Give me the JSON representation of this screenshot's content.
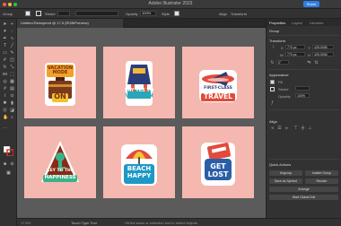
{
  "app": {
    "title": "Adobe Illustrator 2023",
    "share_label": "Share"
  },
  "control_bar": {
    "selection": "Group",
    "stroke_label": "Stroke",
    "opacity_label": "Opacity",
    "opacity_value": "100%",
    "style_label": "Style",
    "align_label": "Align",
    "transform_label": "Transform"
  },
  "document": {
    "tab_label": "Untitled-Reinspired @ 17.5 (RGB/Preview)"
  },
  "status": {
    "zoom": "17.5%",
    "tool_name": "Touch Type Tool",
    "hint": "Hit the lasso or selection tool to select objects"
  },
  "stickers": {
    "s1": {
      "line1": "VACATION",
      "line2": "MODE",
      "line3": "ON"
    },
    "s2": {
      "line1": "SAY YES TO",
      "line2": "VACATION"
    },
    "s3": {
      "line1": "FIRST-CLASS",
      "line2": "TRAVEL"
    },
    "s4": {
      "line1": "KEY TO THE",
      "line2": "HAPPINESS"
    },
    "s5": {
      "line1": "BEACH",
      "line2": "HAPPY"
    },
    "s6": {
      "line1": "GET",
      "line2": "LOST"
    }
  },
  "panel": {
    "tabs": [
      "Properties",
      "Layers",
      "Libraries"
    ],
    "group_label": "Group",
    "transform_head": "Transform",
    "x": "770 px",
    "y": "425.0006",
    "w": "770 px",
    "h": "425.0006",
    "rotate": "0°",
    "appearance_head": "Appearance",
    "fill_label": "Fill",
    "stroke_label": "Stroke",
    "opacity_label": "Opacity",
    "opacity_value": "100%",
    "align_head": "Align",
    "quick_actions_head": "Quick Actions",
    "btn_ungroup": "Ungroup",
    "btn_isolate": "Isolate Group",
    "btn_symbol": "Save as Symbol",
    "btn_recolor": "Recolor",
    "btn_arrange": "Arrange",
    "btn_start_global": "Start Global Edit"
  },
  "colors": {
    "artboard": "#f4b8b0",
    "canvas": "#5b5b5b",
    "accent": "#2f7fe6",
    "panel": "#323232"
  }
}
